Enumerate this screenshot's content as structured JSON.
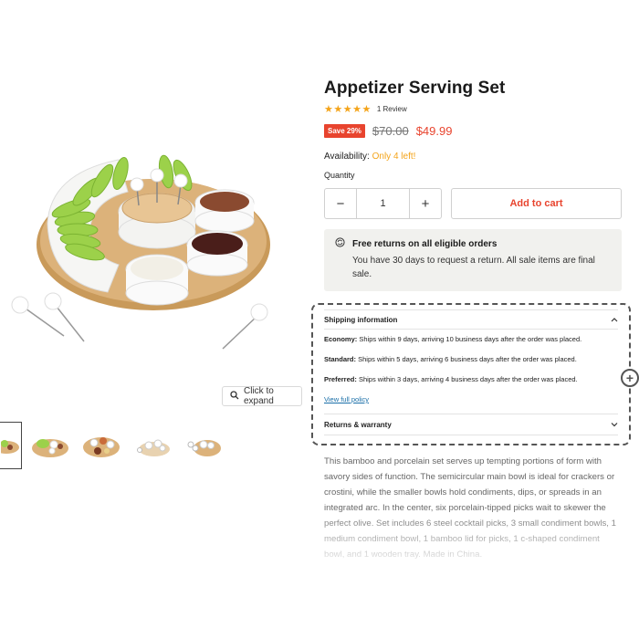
{
  "product": {
    "title": "Appetizer Serving Set",
    "stars": "★★★★★",
    "rating_value": 5,
    "review_count": "1 Review",
    "save_badge": "Save 29%",
    "old_price": "$70.00",
    "new_price": "$49.99",
    "availability_label": "Availability:",
    "availability_value": "Only 4 left!",
    "quantity_label": "Quantity",
    "quantity_value": "1",
    "minus": "−",
    "plus": "+",
    "add_to_cart": "Add to cart"
  },
  "returns": {
    "title": "Free returns on all eligible orders",
    "text": "You have 30 days to request a return. All sale items are final sale."
  },
  "shipping": {
    "header": "Shipping information",
    "economy_label": "Economy:",
    "economy_text": " Ships within 9 days, arriving 10 business days after the order was placed.",
    "standard_label": "Standard:",
    "standard_text": " Ships within 5 days, arriving 6 business days after the order was placed.",
    "preferred_label": "Preferred:",
    "preferred_text": " Ships within 3 days, arriving 4 business days after the order was placed.",
    "policy_link": "View full policy",
    "returns_header": "Returns & warranty"
  },
  "gallery": {
    "expand_label": "Click to expand"
  },
  "description": "This bamboo and porcelain set serves up tempting portions of form with savory sides of function. The semicircular main bowl is ideal for crackers or crostini, while the smaller bowls hold condiments, dips, or spreads in an integrated arc. In the center, six porcelain-tipped picks wait to skewer the perfect olive. Set includes 6 steel cocktail picks, 3 small condiment bowls, 1 medium condiment bowl, 1 bamboo lid for picks, 1 c-shaped condiment bowl, and 1 wooden tray. Made in China.",
  "colors": {
    "accent": "#e8442e",
    "star": "#f4a41a",
    "link": "#1a6fa8"
  }
}
